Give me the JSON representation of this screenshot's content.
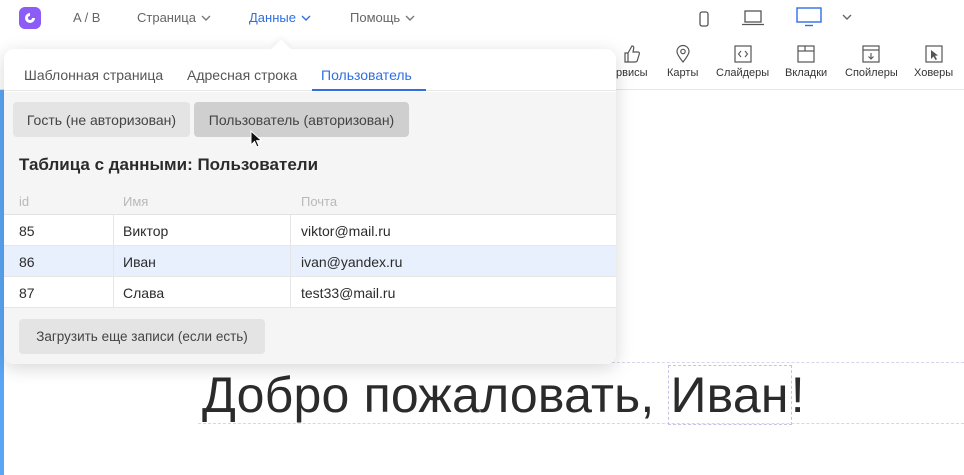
{
  "topbar": {
    "ab_label": "A / B",
    "menus": [
      {
        "label": "Страница",
        "active": false
      },
      {
        "label": "Данные",
        "active": true
      },
      {
        "label": "Помощь",
        "active": false
      }
    ],
    "devices": [
      "phone-icon",
      "laptop-icon",
      "desktop-icon"
    ],
    "accent": "#2f6fe0",
    "logo_color": "#8b5cf6"
  },
  "toolbar": {
    "items": [
      {
        "label": "рвисы",
        "icon": "thumbs-up-icon"
      },
      {
        "label": "Карты",
        "icon": "map-pin-icon"
      },
      {
        "label": "Слайдеры",
        "icon": "code-icon"
      },
      {
        "label": "Вкладки",
        "icon": "tabs-icon"
      },
      {
        "label": "Спойлеры",
        "icon": "spoiler-icon"
      },
      {
        "label": "Ховеры",
        "icon": "cursor-icon"
      }
    ]
  },
  "popover": {
    "tabs": [
      {
        "label": "Шаблонная страница",
        "active": false
      },
      {
        "label": "Адресная строка",
        "active": false
      },
      {
        "label": "Пользователь",
        "active": true
      }
    ],
    "buttons": {
      "guest": "Гость (не авторизован)",
      "user": "Пользователь (авторизован)"
    },
    "heading": "Таблица с данными: Пользователи",
    "table": {
      "columns": [
        "id",
        "Имя",
        "Почта"
      ],
      "rows": [
        {
          "id": "85",
          "name": "Виктор",
          "email": "viktor@mail.ru",
          "highlighted": false
        },
        {
          "id": "86",
          "name": "Иван",
          "email": "ivan@yandex.ru",
          "highlighted": true
        },
        {
          "id": "87",
          "name": "Слава",
          "email": "test33@mail.ru",
          "highlighted": false
        }
      ]
    },
    "load_more": "Загрузить еще записи (если есть)"
  },
  "canvas": {
    "welcome_prefix": "Добро пожаловать, ",
    "welcome_var": "Иван",
    "welcome_suffix": "!"
  }
}
